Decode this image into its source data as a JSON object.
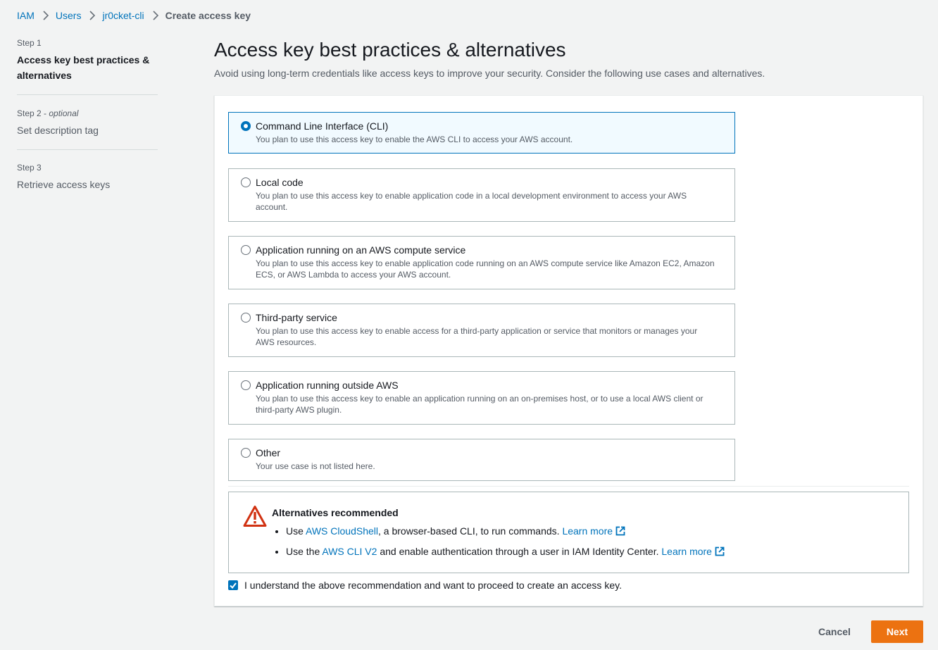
{
  "breadcrumb": {
    "items": [
      "IAM",
      "Users",
      "jr0cket-cli"
    ],
    "current": "Create access key"
  },
  "steps": [
    {
      "label": "Step 1",
      "optional": "",
      "title": "Access key best practices & alternatives",
      "active": true
    },
    {
      "label": "Step 2",
      "optional": "optional",
      "title": "Set description tag",
      "active": false
    },
    {
      "label": "Step 3",
      "optional": "",
      "title": "Retrieve access keys",
      "active": false
    }
  ],
  "header": {
    "title": "Access key best practices & alternatives",
    "description": "Avoid using long-term credentials like access keys to improve your security. Consider the following use cases and alternatives."
  },
  "use_cases": [
    {
      "label": "Command Line Interface (CLI)",
      "description": "You plan to use this access key to enable the AWS CLI to access your AWS account.",
      "selected": true
    },
    {
      "label": "Local code",
      "description": "You plan to use this access key to enable application code in a local development environment to access your AWS account.",
      "selected": false
    },
    {
      "label": "Application running on an AWS compute service",
      "description": "You plan to use this access key to enable application code running on an AWS compute service like Amazon EC2, Amazon ECS, or AWS Lambda to access your AWS account.",
      "selected": false
    },
    {
      "label": "Third-party service",
      "description": "You plan to use this access key to enable access for a third-party application or service that monitors or manages your AWS resources.",
      "selected": false
    },
    {
      "label": "Application running outside AWS",
      "description": "You plan to use this access key to enable an application running on an on-premises host, or to use a local AWS client or third-party AWS plugin.",
      "selected": false
    },
    {
      "label": "Other",
      "description": "Your use case is not listed here.",
      "selected": false
    }
  ],
  "alert": {
    "title": "Alternatives recommended",
    "items": [
      {
        "prefix": "Use ",
        "link": "AWS CloudShell",
        "suffix": ", a browser-based CLI, to run commands. ",
        "learn_more": "Learn more"
      },
      {
        "prefix": "Use the ",
        "link": "AWS CLI V2",
        "suffix": " and enable authentication through a user in IAM Identity Center. ",
        "learn_more": "Learn more"
      }
    ]
  },
  "acknowledge": {
    "label": "I understand the above recommendation and want to proceed to create an access key.",
    "checked": true
  },
  "footer": {
    "cancel_label": "Cancel",
    "next_label": "Next"
  },
  "colors": {
    "link": "#0073bb",
    "primary_button": "#ec7211",
    "warning": "#d13212",
    "selected_tile_bg": "#f1faff"
  }
}
